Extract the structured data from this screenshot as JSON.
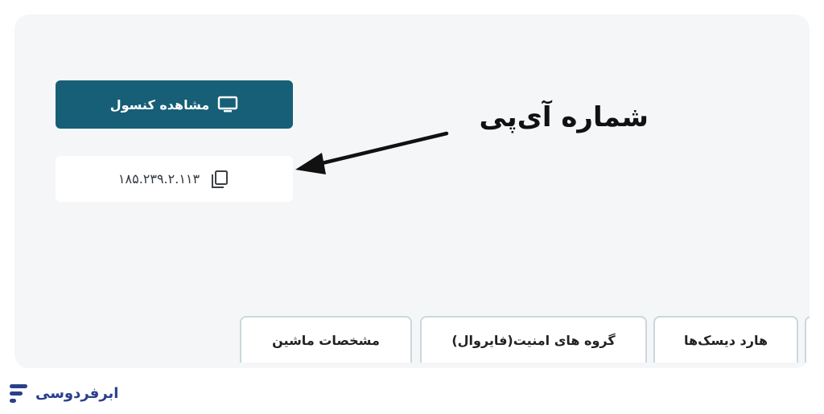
{
  "actions": {
    "console_label": "مشاهده کنسول",
    "ip_address": "۱۸۵.۲۳۹.۲.۱۱۳"
  },
  "annotation": {
    "label": "شماره آی‌پی"
  },
  "tabs": [
    {
      "label": "مشخصات ماشین"
    },
    {
      "label": "گروه های امنیت(فایروال)"
    },
    {
      "label": "هارد دیسک‌ها"
    }
  ],
  "brand": {
    "name": "ابرفردوسی",
    "color": "#2a3f8c"
  },
  "icons": {
    "console": "monitor-icon",
    "copy": "copy-icon",
    "logo": "brand-logo-icon"
  },
  "colors": {
    "primary": "#165f77",
    "panel": "#f5f6f8"
  }
}
